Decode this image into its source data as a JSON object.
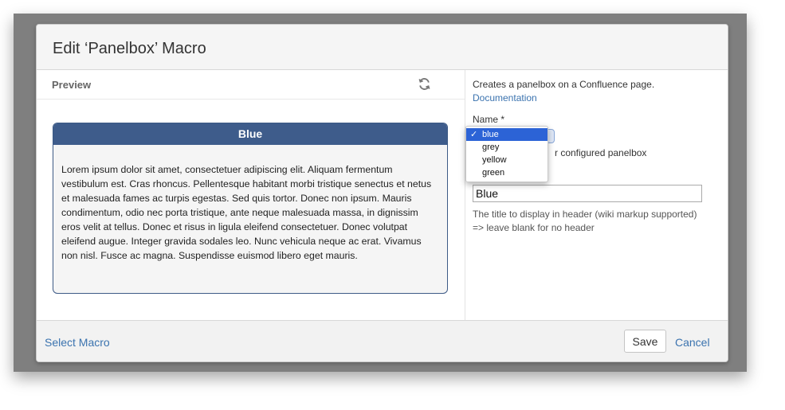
{
  "dialog": {
    "title": "Edit ‘Panelbox’ Macro"
  },
  "preview": {
    "label": "Preview",
    "refresh_icon": "refresh-icon",
    "panel": {
      "title": "Blue",
      "body": "Lorem ipsum dolor sit amet, consectetuer adipiscing elit. Aliquam fermentum vestibulum est. Cras rhoncus. Pellentesque habitant morbi tristique senectus et netus et malesuada fames ac turpis egestas. Sed quis tortor. Donec non ipsum. Mauris condimentum, odio nec porta tristique, ante neque malesuada massa, in dignissim eros velit at tellus. Donec et risus in ligula eleifend consectetuer. Donec volutpat eleifend augue. Integer gravida sodales leo. Nunc vehicula neque ac erat. Vivamus non nisl. Fusce ac magna. Suspendisse euismod libero eget mauris.",
      "header_color": "#3e5c8b"
    }
  },
  "form": {
    "description": "Creates a panelbox on a Confluence page.",
    "doc_link": "Documentation",
    "name_label": "Name *",
    "name_options": [
      "blue",
      "grey",
      "yellow",
      "green"
    ],
    "name_selected": "blue",
    "name_hint_visible": "r configured panelbox",
    "title_value": "Blue",
    "title_help_1": "The title to display in header (wiki markup supported)",
    "title_help_2": "=> leave blank for no header"
  },
  "footer": {
    "select_macro": "Select Macro",
    "save": "Save",
    "cancel": "Cancel"
  },
  "colors": {
    "link": "#3b73af",
    "selected_option": "#2c63d6"
  }
}
